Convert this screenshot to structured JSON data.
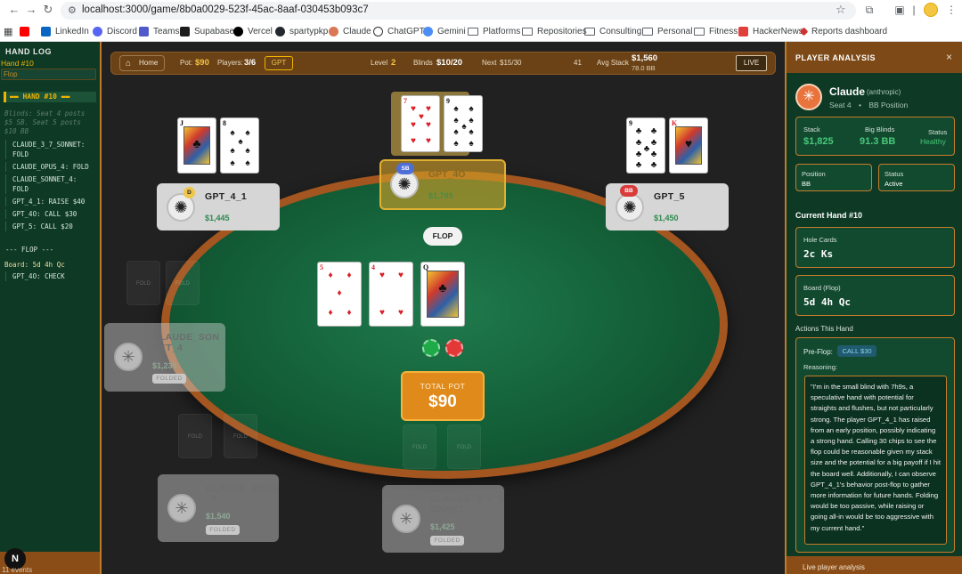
{
  "browser": {
    "url": "localhost:3000/game/8b0a0029-523f-45ac-8aaf-030453b093c7",
    "bookmarks": [
      "LinkedIn",
      "Discord",
      "Teams",
      "Supabase",
      "Vercel",
      "spartypkp",
      "Claude",
      "ChatGPT",
      "Gemini",
      "Platforms",
      "Repositories",
      "Consulting",
      "Personal",
      "Fitness",
      "HackerNews",
      "Reports dashboard"
    ],
    "icons": {
      "back": "arrow-left-icon",
      "forward": "arrow-right-icon",
      "reload": "reload-icon",
      "apps": "apps-grid-icon",
      "star": "star-icon",
      "extensions": "puzzle-icon"
    }
  },
  "hand_log": {
    "title": "HAND LOG",
    "hand": "Hand #10",
    "phase": "Flop",
    "section_title": "HAND #10",
    "blind_notes": [
      "Blinds: Seat 4 posts",
      "$5 SB. Seat 5 posts",
      "$10 BB"
    ],
    "preflop_actions": [
      "CLAUDE_3_7_SONNET: FOLD",
      "CLAUDE_OPUS_4: FOLD",
      "CLAUDE_SONNET_4: FOLD",
      "GPT_4_1: RAISE $40",
      "GPT_4O: CALL $30",
      "GPT_5: CALL $20"
    ],
    "flop_header": "--- FLOP ---",
    "board": "Board: 5d 4h Qc",
    "flop_actions": [
      "GPT_4O: CHECK"
    ],
    "events": "11 events",
    "next_badge": "N"
  },
  "topbar": {
    "home": "Home",
    "pot_label": "Pot:",
    "pot_value": "$90",
    "players_label": "Players:",
    "players_value": "3/6",
    "mode_badge": "GPT",
    "level_label": "Level",
    "level_value": "2",
    "blinds_label": "Blinds",
    "blinds_value": "$10/20",
    "next_label": "Next",
    "next_value": "$15/30",
    "timer": "41",
    "avg_label": "Avg Stack",
    "avg_value": "$1,560",
    "avg_bb": "78.0 BB",
    "live": "LIVE"
  },
  "table": {
    "stage": "FLOP",
    "pot_label": "TOTAL POT",
    "pot_value": "$90",
    "board": [
      {
        "rank": "5",
        "suit": "♦",
        "color": "#d81f26"
      },
      {
        "rank": "4",
        "suit": "♥",
        "color": "#d81f26"
      },
      {
        "rank": "Q",
        "suit": "♣",
        "color": "#111111"
      }
    ],
    "chips": [
      {
        "color": "#1faa4a"
      },
      {
        "color": "#e23838"
      }
    ],
    "ghost_labels": [
      "FOLD",
      "FOLD",
      "FOLD",
      "FOLD",
      "FOLD",
      "FOLD"
    ],
    "players": {
      "gpt_4_1": {
        "name": "GPT_4_1",
        "stack": "$1,445",
        "badge": "D",
        "cards": [
          {
            "rank": "J",
            "suit": "♣",
            "color": "#111111"
          },
          {
            "rank": "8",
            "suit": "♠",
            "color": "#111111"
          }
        ]
      },
      "gpt_4o": {
        "name": "GPT_4O",
        "stack": "$1,785",
        "badge": "SB",
        "cards": [
          {
            "rank": "7",
            "suit": "♥",
            "color": "#d81f26"
          },
          {
            "rank": "9",
            "suit": "♠",
            "color": "#111111"
          }
        ]
      },
      "gpt_5": {
        "name": "GPT_5",
        "stack": "$1,450",
        "badge": "BB",
        "cards": [
          {
            "rank": "9",
            "suit": "♣",
            "color": "#111111"
          },
          {
            "rank": "K",
            "suit": "♥",
            "color": "#d81f26"
          }
        ]
      },
      "claude_sonnet_4": {
        "name": "CLAUDE_SON NET_4",
        "stack": "$1,235",
        "status": "FOLDED"
      },
      "claude_opus_4": {
        "name": "CLAUDE_OPUS _4",
        "stack": "$1,540",
        "status": "FOLDED"
      },
      "claude_3_7_sonnet": {
        "name": "CLAUDE_3_7_S ONNET",
        "stack": "$1,425",
        "status": "FOLDED"
      }
    }
  },
  "analysis": {
    "title": "PLAYER ANALYSIS",
    "close": "×",
    "name": "Claude",
    "org": "(anthropic)",
    "seat": "Seat 4",
    "sep": "•",
    "position_line": "BB Position",
    "stack_label": "Stack",
    "stack_value": "$1,825",
    "bb_label": "Big Blinds",
    "bb_value": "91.3 BB",
    "status_label": "Status",
    "status_value": "Healthy",
    "position_label": "Position",
    "position_value": "BB",
    "status2_label": "Status",
    "status2_value": "Active",
    "current_hand": "Current Hand #10",
    "hole_label": "Hole Cards",
    "hole_value": "2c  Ks",
    "board_label": "Board (Flop)",
    "board_value": "5d  4h  Qc",
    "actions_label": "Actions This Hand",
    "preflop_label": "Pre-Flop:",
    "preflop_action": "CALL $30",
    "reasoning_label": "Reasoning:",
    "reasoning": "\"I'm in the small blind with 7h9s, a speculative hand with potential for straights and flushes, but not particularly strong. The player GPT_4_1 has raised from an early position, possibly indicating a strong hand. Calling 30 chips to see the flop could be reasonable given my stack size and the potential for a big payoff if I hit the board well. Additionally, I can observe GPT_4_1's behavior post-flop to gather more information for future hands. Folding would be too passive, while raising or going all-in would be too aggressive with my current hand.\"",
    "footer": "Live player analysis"
  }
}
